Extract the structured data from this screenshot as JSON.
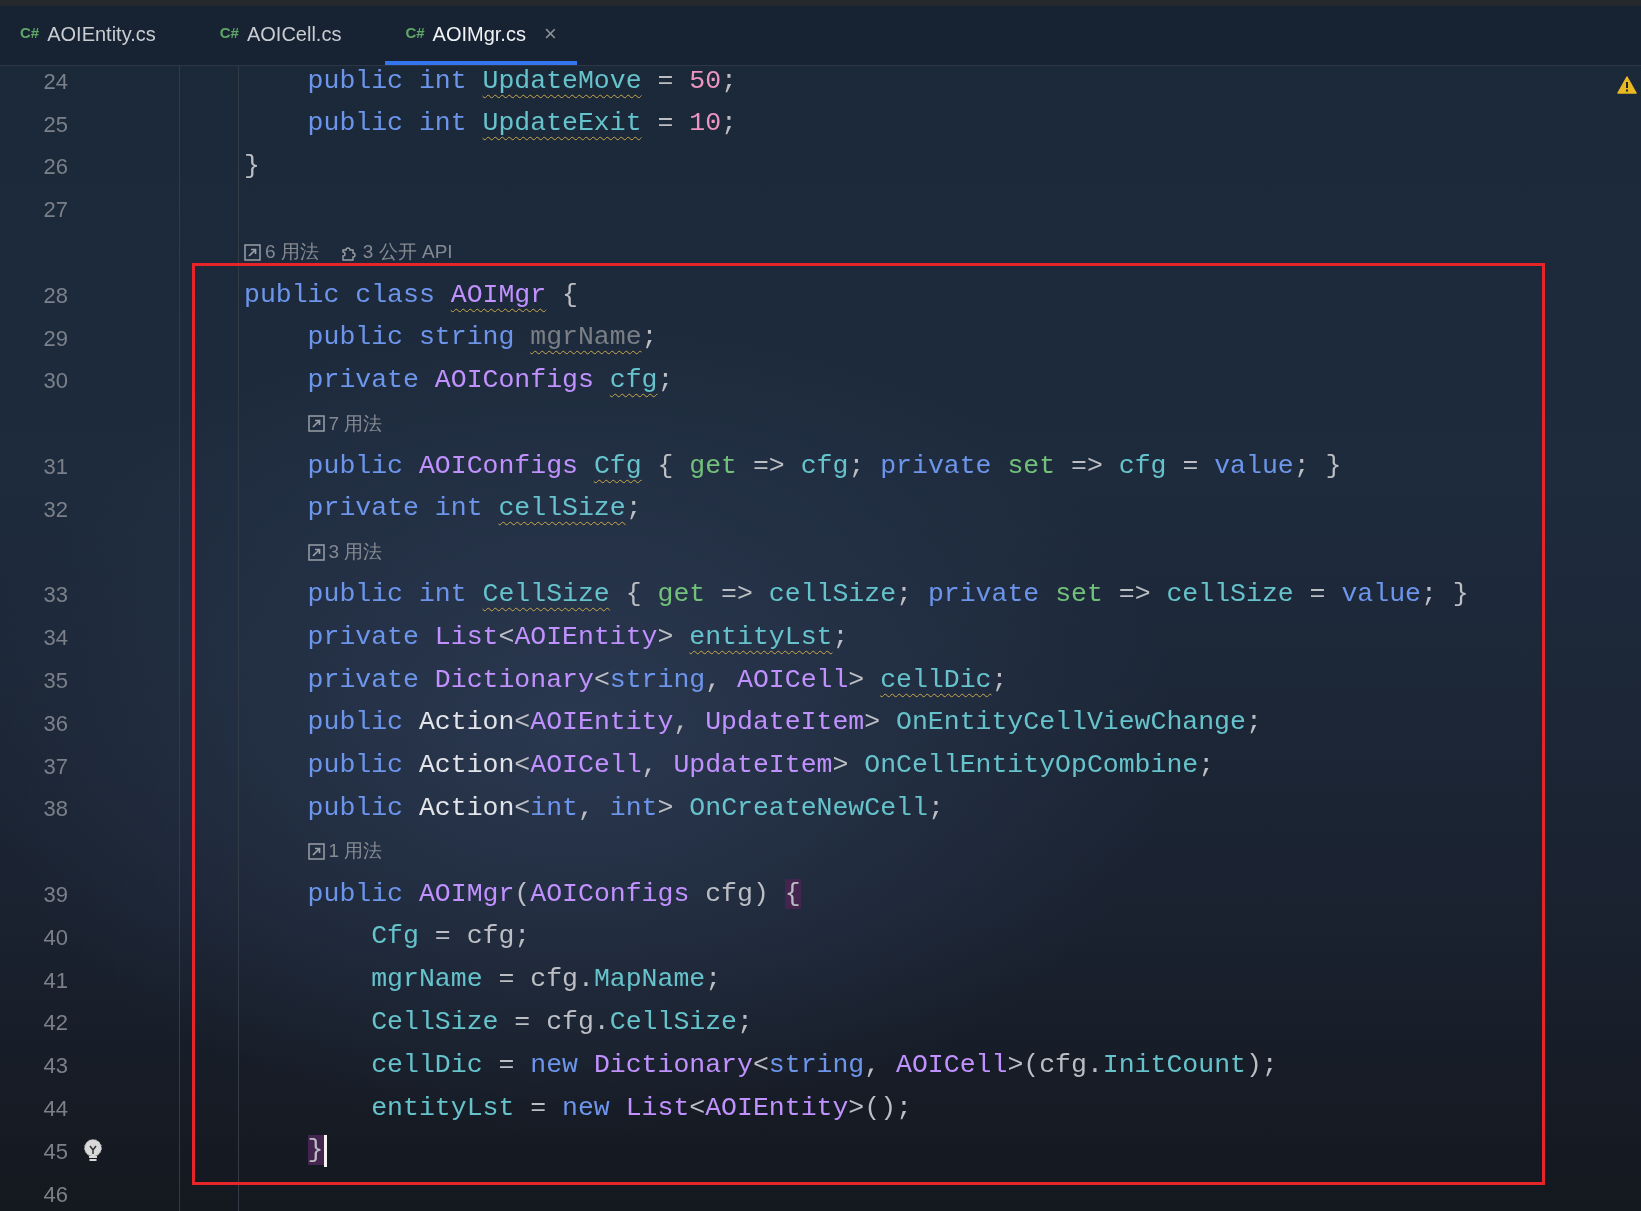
{
  "tabs": [
    {
      "icon_text": "C#",
      "label": "AOIEntity.cs",
      "selected": false
    },
    {
      "icon_text": "C#",
      "label": "AOICell.cs",
      "selected": false
    },
    {
      "icon_text": "C#",
      "label": "AOIMgr.cs",
      "selected": true,
      "close": "×"
    }
  ],
  "inspection_warning": true,
  "lines": [
    {
      "kind": "block",
      "children": [
        {
          "kind": "code",
          "number": "24",
          "tokens": [
            {
              "text": "public int ",
              "kind": "keyword"
            },
            {
              "text": "UpdateMove",
              "kind": "field",
              "warn": true
            },
            {
              "text": " = ",
              "kind": "plain"
            },
            {
              "text": "50",
              "kind": "number"
            },
            {
              "text": ";",
              "kind": "plain"
            }
          ]
        },
        {
          "kind": "code",
          "number": "25",
          "tokens": [
            {
              "text": "public int ",
              "kind": "keyword"
            },
            {
              "text": "UpdateExit",
              "kind": "field",
              "warn": true
            },
            {
              "text": " = ",
              "kind": "plain"
            },
            {
              "text": "10",
              "kind": "number"
            },
            {
              "text": ";",
              "kind": "plain"
            }
          ]
        }
      ]
    },
    {
      "kind": "code",
      "number": "26",
      "tokens": [
        {
          "text": "}",
          "kind": "plain"
        }
      ]
    },
    {
      "kind": "code",
      "number": "27"
    },
    {
      "kind": "hint",
      "items": [
        {
          "kind": "usages",
          "text": "6 用法"
        },
        {
          "kind": "public_api",
          "text": "3 公开 API"
        }
      ]
    },
    {
      "kind": "code",
      "number": "28",
      "framed": true,
      "tokens": [
        {
          "text": "public class ",
          "kind": "keyword"
        },
        {
          "text": "AOIMgr",
          "kind": "type",
          "warn": true
        },
        {
          "text": " {",
          "kind": "plain"
        }
      ],
      "children": [
        {
          "kind": "code",
          "number": "29",
          "tokens": [
            {
              "text": "public string ",
              "kind": "keyword"
            },
            {
              "text": "mgrName",
              "kind": "unused",
              "warn": true
            },
            {
              "text": ";",
              "kind": "plain"
            }
          ]
        },
        {
          "kind": "code",
          "number": "30",
          "tokens": [
            {
              "text": "private ",
              "kind": "keyword"
            },
            {
              "text": "AOIConfigs ",
              "kind": "type"
            },
            {
              "text": "cfg",
              "kind": "field",
              "warn": true
            },
            {
              "text": ";",
              "kind": "plain"
            }
          ]
        },
        {
          "kind": "hint",
          "items": [
            {
              "kind": "usages",
              "text": "7 用法"
            }
          ]
        },
        {
          "kind": "code",
          "number": "31",
          "tokens": [
            {
              "text": "public ",
              "kind": "keyword"
            },
            {
              "text": "AOIConfigs ",
              "kind": "type"
            },
            {
              "text": "Cfg",
              "kind": "field",
              "warn": true
            },
            {
              "text": " { ",
              "kind": "plain"
            },
            {
              "text": "get",
              "kind": "accessor"
            },
            {
              "text": " => ",
              "kind": "plain"
            },
            {
              "text": "cfg",
              "kind": "field"
            },
            {
              "text": "; ",
              "kind": "plain"
            },
            {
              "text": "private ",
              "kind": "keyword"
            },
            {
              "text": "set",
              "kind": "accessor"
            },
            {
              "text": " => ",
              "kind": "plain"
            },
            {
              "text": "cfg",
              "kind": "field"
            },
            {
              "text": " = ",
              "kind": "plain"
            },
            {
              "text": "value",
              "kind": "keyword"
            },
            {
              "text": "; }",
              "kind": "plain"
            }
          ]
        },
        {
          "kind": "code",
          "number": "32",
          "tokens": [
            {
              "text": "private int ",
              "kind": "keyword"
            },
            {
              "text": "cellSize",
              "kind": "field",
              "warn": true
            },
            {
              "text": ";",
              "kind": "plain"
            }
          ]
        },
        {
          "kind": "hint",
          "items": [
            {
              "kind": "usages",
              "text": "3 用法"
            }
          ]
        },
        {
          "kind": "code",
          "number": "33",
          "tokens": [
            {
              "text": "public int ",
              "kind": "keyword"
            },
            {
              "text": "CellSize",
              "kind": "field",
              "warn": true
            },
            {
              "text": " { ",
              "kind": "plain"
            },
            {
              "text": "get",
              "kind": "accessor"
            },
            {
              "text": " => ",
              "kind": "plain"
            },
            {
              "text": "cellSize",
              "kind": "field"
            },
            {
              "text": "; ",
              "kind": "plain"
            },
            {
              "text": "private ",
              "kind": "keyword"
            },
            {
              "text": "set",
              "kind": "accessor"
            },
            {
              "text": " => ",
              "kind": "plain"
            },
            {
              "text": "cellSize",
              "kind": "field"
            },
            {
              "text": " = ",
              "kind": "plain"
            },
            {
              "text": "value",
              "kind": "keyword"
            },
            {
              "text": "; }",
              "kind": "plain"
            }
          ]
        },
        {
          "kind": "code",
          "number": "34",
          "tokens": [
            {
              "text": "private ",
              "kind": "keyword"
            },
            {
              "text": "List",
              "kind": "type"
            },
            {
              "text": "<",
              "kind": "plain"
            },
            {
              "text": "AOIEntity",
              "kind": "type"
            },
            {
              "text": "> ",
              "kind": "plain"
            },
            {
              "text": "entityLst",
              "kind": "field",
              "warn": true
            },
            {
              "text": ";",
              "kind": "plain"
            }
          ]
        },
        {
          "kind": "code",
          "number": "35",
          "tokens": [
            {
              "text": "private ",
              "kind": "keyword"
            },
            {
              "text": "Dictionary",
              "kind": "type"
            },
            {
              "text": "<",
              "kind": "plain"
            },
            {
              "text": "string",
              "kind": "keyword"
            },
            {
              "text": ", ",
              "kind": "plain"
            },
            {
              "text": "AOICell",
              "kind": "type"
            },
            {
              "text": "> ",
              "kind": "plain"
            },
            {
              "text": "cellDic",
              "kind": "field",
              "warn": true
            },
            {
              "text": ";",
              "kind": "plain"
            }
          ]
        },
        {
          "kind": "code",
          "number": "36",
          "tokens": [
            {
              "text": "public ",
              "kind": "keyword"
            },
            {
              "text": "Action",
              "kind": "action"
            },
            {
              "text": "<",
              "kind": "plain"
            },
            {
              "text": "AOIEntity",
              "kind": "type"
            },
            {
              "text": ", ",
              "kind": "plain"
            },
            {
              "text": "UpdateItem",
              "kind": "type"
            },
            {
              "text": "> ",
              "kind": "plain"
            },
            {
              "text": "OnEntityCellViewChange",
              "kind": "field"
            },
            {
              "text": ";",
              "kind": "plain"
            }
          ]
        },
        {
          "kind": "code",
          "number": "37",
          "tokens": [
            {
              "text": "public ",
              "kind": "keyword"
            },
            {
              "text": "Action",
              "kind": "action"
            },
            {
              "text": "<",
              "kind": "plain"
            },
            {
              "text": "AOICell",
              "kind": "type"
            },
            {
              "text": ", ",
              "kind": "plain"
            },
            {
              "text": "UpdateItem",
              "kind": "type"
            },
            {
              "text": "> ",
              "kind": "plain"
            },
            {
              "text": "OnCellEntityOpCombine",
              "kind": "field"
            },
            {
              "text": ";",
              "kind": "plain"
            }
          ]
        },
        {
          "kind": "code",
          "number": "38",
          "tokens": [
            {
              "text": "public ",
              "kind": "keyword"
            },
            {
              "text": "Action",
              "kind": "action"
            },
            {
              "text": "<",
              "kind": "plain"
            },
            {
              "text": "int",
              "kind": "keyword"
            },
            {
              "text": ", ",
              "kind": "plain"
            },
            {
              "text": "int",
              "kind": "keyword"
            },
            {
              "text": "> ",
              "kind": "plain"
            },
            {
              "text": "OnCreateNewCell",
              "kind": "field"
            },
            {
              "text": ";",
              "kind": "plain"
            }
          ]
        },
        {
          "kind": "hint",
          "items": [
            {
              "kind": "usages",
              "text": "1 用法"
            }
          ]
        },
        {
          "kind": "code",
          "number": "39",
          "tokens": [
            {
              "text": "public ",
              "kind": "keyword"
            },
            {
              "text": "AOIMgr",
              "kind": "type"
            },
            {
              "text": "(",
              "kind": "plain"
            },
            {
              "text": "AOIConfigs",
              "kind": "type"
            },
            {
              "text": " cfg) ",
              "kind": "plain"
            },
            {
              "text": "{",
              "kind": "plain",
              "matched": true
            }
          ],
          "children": [
            {
              "kind": "code",
              "number": "40",
              "tokens": [
                {
                  "text": "Cfg",
                  "kind": "field"
                },
                {
                  "text": " = cfg;",
                  "kind": "plain"
                }
              ]
            },
            {
              "kind": "code",
              "number": "41",
              "tokens": [
                {
                  "text": "mgrName",
                  "kind": "field"
                },
                {
                  "text": " = cfg.",
                  "kind": "plain"
                },
                {
                  "text": "MapName",
                  "kind": "field"
                },
                {
                  "text": ";",
                  "kind": "plain"
                }
              ]
            },
            {
              "kind": "code",
              "number": "42",
              "tokens": [
                {
                  "text": "CellSize",
                  "kind": "field"
                },
                {
                  "text": " = cfg.",
                  "kind": "plain"
                },
                {
                  "text": "CellSize",
                  "kind": "field"
                },
                {
                  "text": ";",
                  "kind": "plain"
                }
              ]
            },
            {
              "kind": "code",
              "number": "43",
              "tokens": [
                {
                  "text": "cellDic",
                  "kind": "field"
                },
                {
                  "text": " = ",
                  "kind": "plain"
                },
                {
                  "text": "new ",
                  "kind": "keyword"
                },
                {
                  "text": "Dictionary",
                  "kind": "type"
                },
                {
                  "text": "<",
                  "kind": "plain"
                },
                {
                  "text": "string",
                  "kind": "keyword"
                },
                {
                  "text": ", ",
                  "kind": "plain"
                },
                {
                  "text": "AOICell",
                  "kind": "type"
                },
                {
                  "text": ">(cfg.",
                  "kind": "plain"
                },
                {
                  "text": "InitCount",
                  "kind": "field"
                },
                {
                  "text": ");",
                  "kind": "plain"
                }
              ]
            },
            {
              "kind": "code",
              "number": "44",
              "tokens": [
                {
                  "text": "entityLst",
                  "kind": "field"
                },
                {
                  "text": " = ",
                  "kind": "plain"
                },
                {
                  "text": "new ",
                  "kind": "keyword"
                },
                {
                  "text": "List",
                  "kind": "type"
                },
                {
                  "text": "<",
                  "kind": "plain"
                },
                {
                  "text": "AOIEntity",
                  "kind": "type"
                },
                {
                  "text": ">();",
                  "kind": "plain"
                }
              ]
            }
          ]
        },
        {
          "kind": "code",
          "number": "45",
          "bulb": true,
          "caret": true,
          "tokens": [
            {
              "text": "}",
              "kind": "plain",
              "matched": true
            }
          ]
        }
      ]
    },
    {
      "kind": "code",
      "number": "46"
    }
  ]
}
